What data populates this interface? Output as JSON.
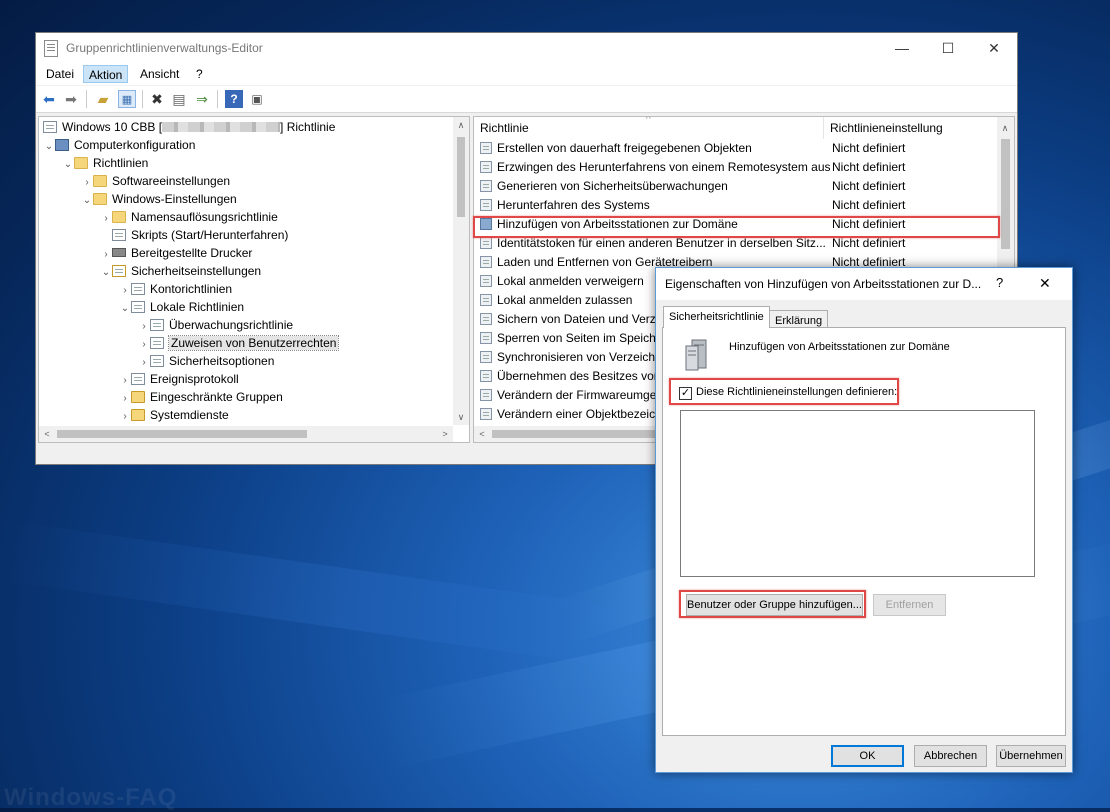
{
  "watermark": "Windows-FAQ",
  "window": {
    "title": "Gruppenrichtlinienverwaltungs-Editor",
    "controls": [
      "—",
      "☐",
      "✕"
    ]
  },
  "menu": [
    "Datei",
    "Aktion",
    "Ansicht",
    "?"
  ],
  "tree": {
    "root": "Windows 10 CBB [",
    "root_suffix": "] Richtlinie",
    "items": [
      {
        "label": "Computerkonfiguration",
        "icon": "computer-icon"
      },
      {
        "label": "Richtlinien",
        "icon": "folder-icon"
      },
      {
        "label": "Softwareeinstellungen",
        "icon": "folder-icon"
      },
      {
        "label": "Windows-Einstellungen",
        "icon": "folder-icon"
      },
      {
        "label": "Namensauflösungsrichtlinie",
        "icon": "folder-icon"
      },
      {
        "label": "Skripts (Start/Herunterfahren)",
        "icon": "script-icon"
      },
      {
        "label": "Bereitgestellte Drucker",
        "icon": "printer-icon"
      },
      {
        "label": "Sicherheitseinstellungen",
        "icon": "security-icon"
      },
      {
        "label": "Kontorichtlinien",
        "icon": "policy-folder-icon"
      },
      {
        "label": "Lokale Richtlinien",
        "icon": "policy-folder-icon"
      },
      {
        "label": "Überwachungsrichtlinie",
        "icon": "policy-folder-icon"
      },
      {
        "label": "Zuweisen von Benutzerrechten",
        "icon": "policy-folder-icon"
      },
      {
        "label": "Sicherheitsoptionen",
        "icon": "policy-folder-icon"
      },
      {
        "label": "Ereignisprotokoll",
        "icon": "policy-folder-icon"
      },
      {
        "label": "Eingeschränkte Gruppen",
        "icon": "lock-folder-icon"
      },
      {
        "label": "Systemdienste",
        "icon": "lock-folder-icon"
      }
    ]
  },
  "list": {
    "col_policy": "Richtlinie",
    "col_setting": "Richtlinieneinstellung",
    "rows": [
      {
        "policy": "Erstellen von dauerhaft freigegebenen Objekten",
        "setting": "Nicht definiert"
      },
      {
        "policy": "Erzwingen des Herunterfahrens von einem Remotesystem aus",
        "setting": "Nicht definiert"
      },
      {
        "policy": "Generieren von Sicherheitsüberwachungen",
        "setting": "Nicht definiert"
      },
      {
        "policy": "Herunterfahren des Systems",
        "setting": "Nicht definiert"
      },
      {
        "policy": "Hinzufügen von Arbeitsstationen zur Domäne",
        "setting": "Nicht definiert"
      },
      {
        "policy": "Identitätstoken für einen anderen Benutzer in derselben Sitz...",
        "setting": "Nicht definiert"
      },
      {
        "policy": "Laden und Entfernen von Gerätetreibern",
        "setting": "Nicht definiert"
      },
      {
        "policy": "Lokal anmelden verweigern",
        "setting": ""
      },
      {
        "policy": "Lokal anmelden zulassen",
        "setting": ""
      },
      {
        "policy": "Sichern von Dateien und Verze",
        "setting": ""
      },
      {
        "policy": "Sperren von Seiten im Speiche",
        "setting": ""
      },
      {
        "policy": "Synchronisieren von Verzeichn",
        "setting": ""
      },
      {
        "policy": "Übernehmen des Besitzes von",
        "setting": ""
      },
      {
        "policy": "Verändern der Firmwareumgeb",
        "setting": ""
      },
      {
        "policy": "Verändern einer Objektbezeich",
        "setting": ""
      }
    ]
  },
  "dialog": {
    "title": "Eigenschaften von Hinzufügen von Arbeitsstationen zur D...",
    "help": "?",
    "close": "✕",
    "tab_policy": "Sicherheitsrichtlinie",
    "tab_explain": "Erklärung",
    "policy_name": "Hinzufügen von Arbeitsstationen zur Domäne",
    "checkbox_label": "Diese Richtlinieneinstellungen definieren:",
    "checkbox_checked": true,
    "add_button": "Benutzer oder Gruppe hinzufügen...",
    "remove_button": "Entfernen",
    "ok": "OK",
    "cancel": "Abbrechen",
    "apply": "Übernehmen"
  },
  "colors": {
    "highlight": "#e04848",
    "accent": "#0078d7"
  }
}
